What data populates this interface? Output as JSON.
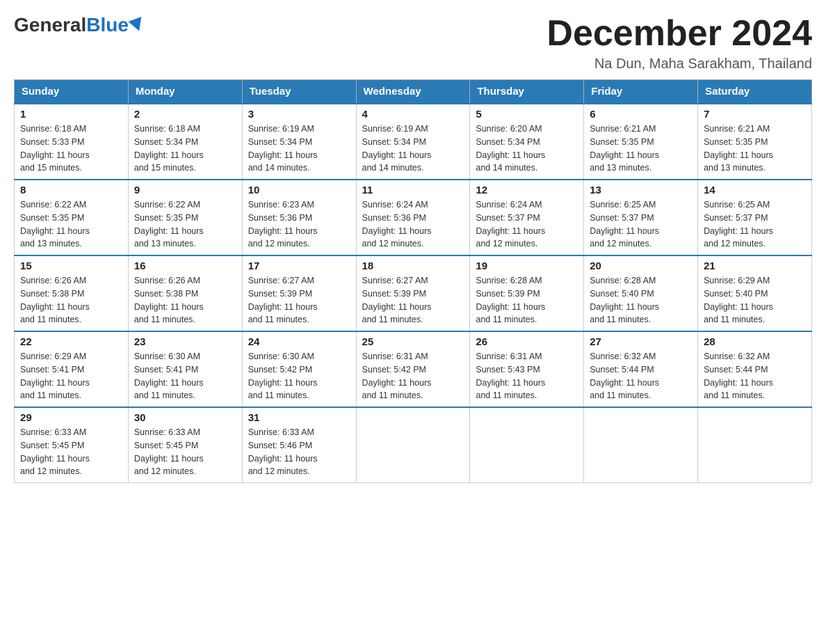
{
  "header": {
    "logo": {
      "general": "General",
      "blue": "Blue"
    },
    "title": "December 2024",
    "location": "Na Dun, Maha Sarakham, Thailand"
  },
  "weekdays": [
    "Sunday",
    "Monday",
    "Tuesday",
    "Wednesday",
    "Thursday",
    "Friday",
    "Saturday"
  ],
  "weeks": [
    [
      {
        "day": "1",
        "sunrise": "6:18 AM",
        "sunset": "5:33 PM",
        "daylight": "11 hours and 15 minutes."
      },
      {
        "day": "2",
        "sunrise": "6:18 AM",
        "sunset": "5:34 PM",
        "daylight": "11 hours and 15 minutes."
      },
      {
        "day": "3",
        "sunrise": "6:19 AM",
        "sunset": "5:34 PM",
        "daylight": "11 hours and 14 minutes."
      },
      {
        "day": "4",
        "sunrise": "6:19 AM",
        "sunset": "5:34 PM",
        "daylight": "11 hours and 14 minutes."
      },
      {
        "day": "5",
        "sunrise": "6:20 AM",
        "sunset": "5:34 PM",
        "daylight": "11 hours and 14 minutes."
      },
      {
        "day": "6",
        "sunrise": "6:21 AM",
        "sunset": "5:35 PM",
        "daylight": "11 hours and 13 minutes."
      },
      {
        "day": "7",
        "sunrise": "6:21 AM",
        "sunset": "5:35 PM",
        "daylight": "11 hours and 13 minutes."
      }
    ],
    [
      {
        "day": "8",
        "sunrise": "6:22 AM",
        "sunset": "5:35 PM",
        "daylight": "11 hours and 13 minutes."
      },
      {
        "day": "9",
        "sunrise": "6:22 AM",
        "sunset": "5:35 PM",
        "daylight": "11 hours and 13 minutes."
      },
      {
        "day": "10",
        "sunrise": "6:23 AM",
        "sunset": "5:36 PM",
        "daylight": "11 hours and 12 minutes."
      },
      {
        "day": "11",
        "sunrise": "6:24 AM",
        "sunset": "5:36 PM",
        "daylight": "11 hours and 12 minutes."
      },
      {
        "day": "12",
        "sunrise": "6:24 AM",
        "sunset": "5:37 PM",
        "daylight": "11 hours and 12 minutes."
      },
      {
        "day": "13",
        "sunrise": "6:25 AM",
        "sunset": "5:37 PM",
        "daylight": "11 hours and 12 minutes."
      },
      {
        "day": "14",
        "sunrise": "6:25 AM",
        "sunset": "5:37 PM",
        "daylight": "11 hours and 12 minutes."
      }
    ],
    [
      {
        "day": "15",
        "sunrise": "6:26 AM",
        "sunset": "5:38 PM",
        "daylight": "11 hours and 11 minutes."
      },
      {
        "day": "16",
        "sunrise": "6:26 AM",
        "sunset": "5:38 PM",
        "daylight": "11 hours and 11 minutes."
      },
      {
        "day": "17",
        "sunrise": "6:27 AM",
        "sunset": "5:39 PM",
        "daylight": "11 hours and 11 minutes."
      },
      {
        "day": "18",
        "sunrise": "6:27 AM",
        "sunset": "5:39 PM",
        "daylight": "11 hours and 11 minutes."
      },
      {
        "day": "19",
        "sunrise": "6:28 AM",
        "sunset": "5:39 PM",
        "daylight": "11 hours and 11 minutes."
      },
      {
        "day": "20",
        "sunrise": "6:28 AM",
        "sunset": "5:40 PM",
        "daylight": "11 hours and 11 minutes."
      },
      {
        "day": "21",
        "sunrise": "6:29 AM",
        "sunset": "5:40 PM",
        "daylight": "11 hours and 11 minutes."
      }
    ],
    [
      {
        "day": "22",
        "sunrise": "6:29 AM",
        "sunset": "5:41 PM",
        "daylight": "11 hours and 11 minutes."
      },
      {
        "day": "23",
        "sunrise": "6:30 AM",
        "sunset": "5:41 PM",
        "daylight": "11 hours and 11 minutes."
      },
      {
        "day": "24",
        "sunrise": "6:30 AM",
        "sunset": "5:42 PM",
        "daylight": "11 hours and 11 minutes."
      },
      {
        "day": "25",
        "sunrise": "6:31 AM",
        "sunset": "5:42 PM",
        "daylight": "11 hours and 11 minutes."
      },
      {
        "day": "26",
        "sunrise": "6:31 AM",
        "sunset": "5:43 PM",
        "daylight": "11 hours and 11 minutes."
      },
      {
        "day": "27",
        "sunrise": "6:32 AM",
        "sunset": "5:44 PM",
        "daylight": "11 hours and 11 minutes."
      },
      {
        "day": "28",
        "sunrise": "6:32 AM",
        "sunset": "5:44 PM",
        "daylight": "11 hours and 11 minutes."
      }
    ],
    [
      {
        "day": "29",
        "sunrise": "6:33 AM",
        "sunset": "5:45 PM",
        "daylight": "11 hours and 12 minutes."
      },
      {
        "day": "30",
        "sunrise": "6:33 AM",
        "sunset": "5:45 PM",
        "daylight": "11 hours and 12 minutes."
      },
      {
        "day": "31",
        "sunrise": "6:33 AM",
        "sunset": "5:46 PM",
        "daylight": "11 hours and 12 minutes."
      },
      null,
      null,
      null,
      null
    ]
  ],
  "labels": {
    "sunrise": "Sunrise:",
    "sunset": "Sunset:",
    "daylight": "Daylight:"
  }
}
